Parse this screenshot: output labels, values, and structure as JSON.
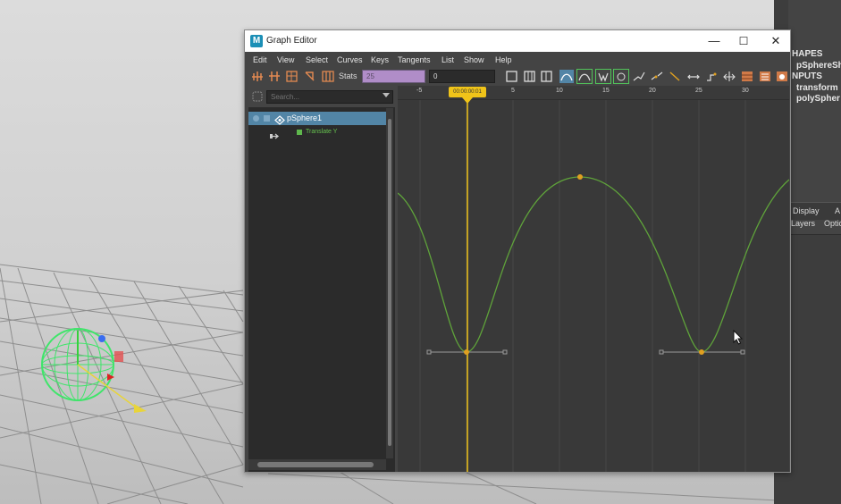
{
  "window": {
    "title": "Graph Editor",
    "app_icon": "M",
    "min_glyph": "—",
    "max_glyph": "☐",
    "close_glyph": "✕"
  },
  "menu": [
    "Edit",
    "View",
    "Select",
    "Curves",
    "Keys",
    "Tangents",
    "List",
    "Show",
    "Help"
  ],
  "toolbar": {
    "stats_label": "Stats",
    "stats_value_1": "25",
    "stats_value_2": "0",
    "icons": [
      "insert-keys-icon",
      "lattice-keys-icon",
      "region-tool-icon",
      "retime-tool-icon",
      "grid-snap-icon",
      "frame-all-icon",
      "frame-selection-icon",
      "frame-playback-icon",
      "auto-tangent-icon",
      "spline-tangent-icon",
      "weighted-tangent-icon",
      "clamped-tangent-icon",
      "linear-tangent-icon",
      "flat-tangent-icon",
      "step-tangent-icon",
      "plateau-tangent-icon",
      "buffer-curve-icon",
      "swap-buffer-icon",
      "break-tangent-icon",
      "unify-tangent-icon",
      "infinity-icon"
    ]
  },
  "outliner": {
    "search_placeholder": "Search...",
    "node_label": "pSphere1",
    "attribute_label": "Translate Y"
  },
  "graph": {
    "current_time": "00:00:00:01",
    "time_ticks": [
      "-5",
      "0",
      "5",
      "10",
      "15",
      "20",
      "25",
      "30"
    ],
    "curve_color": "#5fa33a",
    "key_color": "#e0a020",
    "playhead_color": "#f0c419"
  },
  "channel_box": {
    "lines": [
      "HAPES",
      "pSphereSh",
      "NPUTS",
      "transform",
      "polySpher"
    ],
    "layer_tabs": [
      "Display",
      "A"
    ],
    "layer_menu": [
      "Layers",
      "Optio"
    ]
  }
}
